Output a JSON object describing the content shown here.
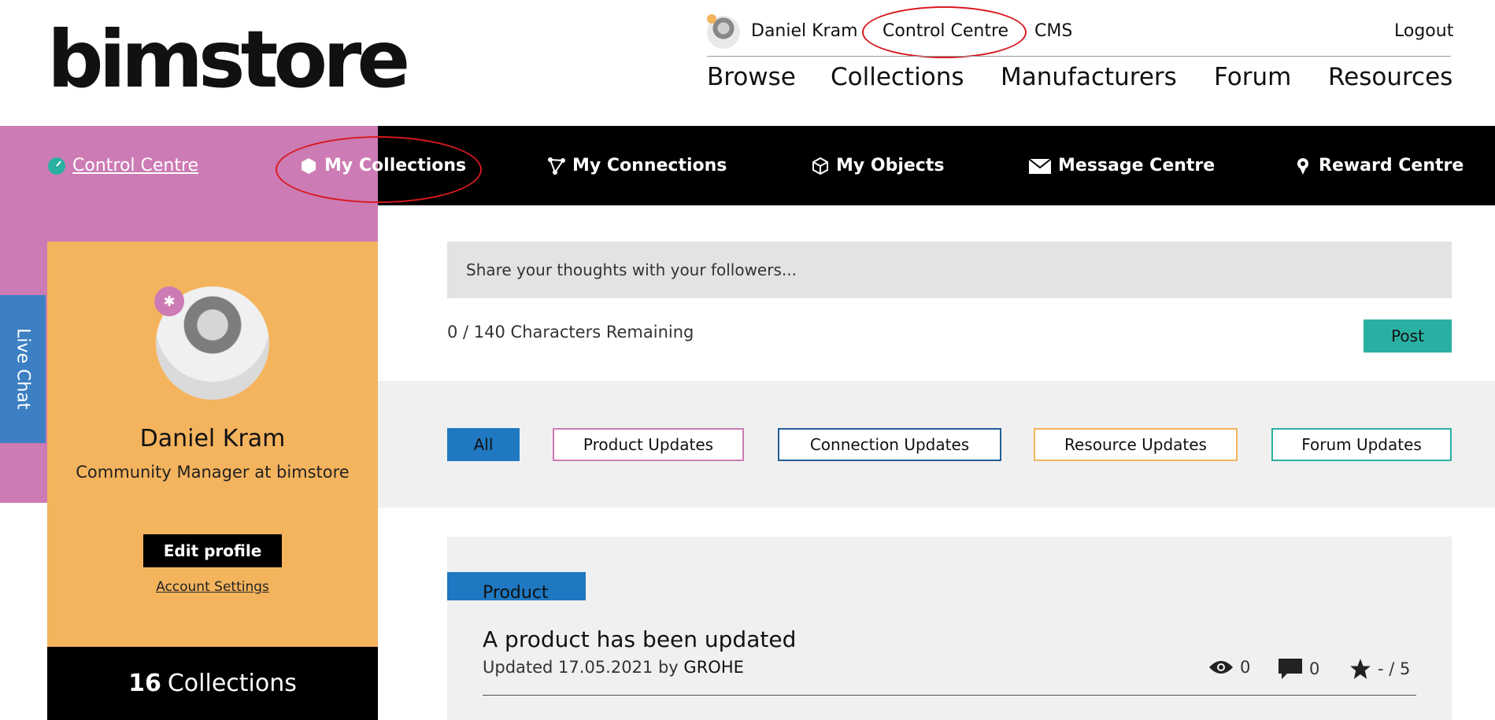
{
  "brand": {
    "logo_text": "bimstore"
  },
  "utility_bar": {
    "user_name": "Daniel Kram",
    "control_centre": "Control Centre",
    "cms": "CMS",
    "logout": "Logout"
  },
  "main_nav": [
    "Browse",
    "Collections",
    "Manufacturers",
    "Forum",
    "Resources"
  ],
  "sub_nav": {
    "control_centre": "Control Centre",
    "my_collections": "My Collections",
    "my_connections": "My Connections",
    "my_objects": "My Objects",
    "message_centre": "Message Centre",
    "reward_centre": "Reward Centre"
  },
  "live_chat": "Live Chat",
  "profile": {
    "name": "Daniel Kram",
    "title": "Community Manager at bimstore",
    "edit_label": "Edit profile",
    "account_settings": "Account Settings",
    "collections_count": "16",
    "collections_label": "Collections"
  },
  "post_box": {
    "placeholder": "Share your thoughts with your followers...",
    "char_count": "0 / 140 Characters Remaining",
    "post_label": "Post"
  },
  "filters": [
    {
      "label": "All",
      "color": "#1f78c1"
    },
    {
      "label": "Product Updates",
      "color": "#cd7bb4"
    },
    {
      "label": "Connection Updates",
      "color": "#1f5f97"
    },
    {
      "label": "Resource Updates",
      "color": "#f4b45e"
    },
    {
      "label": "Forum Updates",
      "color": "#2ab0a3"
    }
  ],
  "feed": [
    {
      "tag": "Product",
      "title": "A product has been updated",
      "updated_prefix": "Updated 17.05.2021 by",
      "author": "GROHE",
      "views": "0",
      "comments": "0",
      "rating": "- / 5"
    }
  ],
  "colors": {
    "accent_pink": "#cd7bb4",
    "accent_orange": "#f4b45e",
    "accent_blue": "#1f78c1",
    "accent_teal": "#2ab0a3",
    "annotation_red": "#d71920"
  }
}
